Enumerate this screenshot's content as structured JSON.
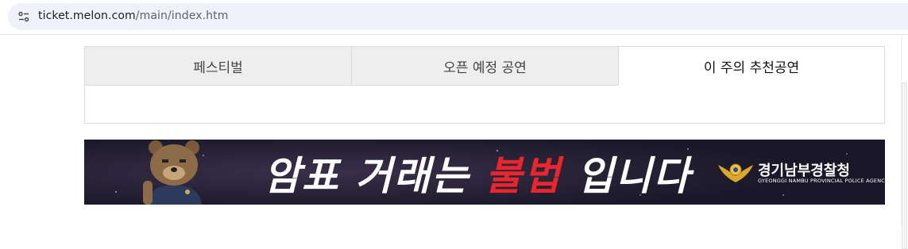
{
  "browser": {
    "url_host": "ticket.melon.com",
    "url_path": "/main/index.htm"
  },
  "tabs": [
    {
      "label": "페스티벌",
      "active": false
    },
    {
      "label": "오픈 예정 공연",
      "active": false
    },
    {
      "label": "이 주의 추천공연",
      "active": true
    }
  ],
  "banner": {
    "headline_part1": "암표 거래는 ",
    "headline_red": "불법",
    "headline_part2": " 입니다",
    "org_name": "경기남부경찰청",
    "org_name_en": "GYEONGGI NAMBU PROVINCIAL POLICE AGENCY"
  },
  "colors": {
    "banner_bg": "#1d1b2e",
    "accent_red": "#e8262b",
    "tab_inactive": "#eeeeee"
  }
}
